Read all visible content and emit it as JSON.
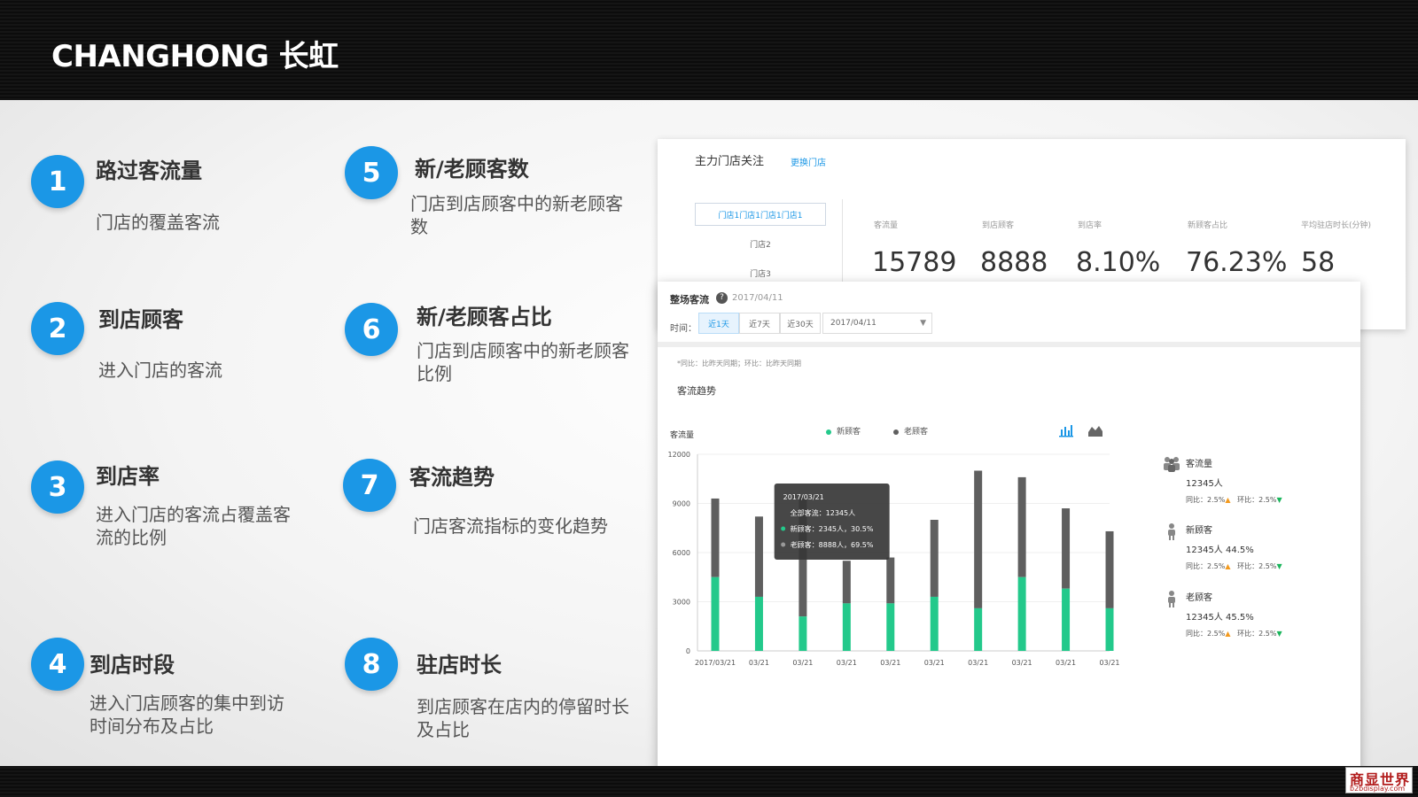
{
  "brand": {
    "logo_text": "CHANGHONG 长虹"
  },
  "features": [
    {
      "num": "1",
      "title": "路过客流量",
      "desc": "门店的覆盖客流"
    },
    {
      "num": "2",
      "title": "到店顾客",
      "desc": "进入门店的客流"
    },
    {
      "num": "3",
      "title": "到店率",
      "desc": "进入门店的客流占覆盖客流的比例"
    },
    {
      "num": "4",
      "title": "到店时段",
      "desc": "进入门店顾客的集中到访时间分布及占比"
    },
    {
      "num": "5",
      "title": "新/老顾客数",
      "desc": "门店到店顾客中的新老顾客数"
    },
    {
      "num": "6",
      "title": "新/老顾客占比",
      "desc": "门店到店顾客中的新老顾客比例"
    },
    {
      "num": "7",
      "title": "客流趋势",
      "desc": "门店客流指标的变化趋势"
    },
    {
      "num": "8",
      "title": "驻店时长",
      "desc": "到店顾客在店内的停留时长及占比"
    }
  ],
  "store_panel": {
    "title": "主力门店关注",
    "change_link": "更换门店",
    "selected_store": "门店1门店1门店1门店1",
    "stores": [
      "门店2",
      "门店3"
    ],
    "metrics": [
      {
        "label": "客流量",
        "value": "15789"
      },
      {
        "label": "到店顾客",
        "value": "8888"
      },
      {
        "label": "到店率",
        "value": "8.10%"
      },
      {
        "label": "新顾客占比",
        "value": "76.23%"
      },
      {
        "label": "平均驻店时长(分钟)",
        "value": "58"
      }
    ]
  },
  "traffic_panel": {
    "title": "整场客流",
    "help": "?",
    "date": "2017/04/11",
    "time_label": "时间：",
    "tabs": [
      "近1天",
      "近7天",
      "近30天"
    ],
    "date_select": "2017/04/11",
    "note": "*同比：比昨天同期；环比：比昨天同期",
    "section_title": "客流趋势",
    "y_axis_label": "客流量",
    "legend_new": "新顾客",
    "legend_old": "老顾客",
    "tooltip": {
      "date": "2017/03/21",
      "total": "全部客流：12345人",
      "new": "新顾客：2345人，30.5%",
      "old": "老顾客：8888人，69.5%"
    },
    "stats": [
      {
        "title": "客流量",
        "value": "12345人",
        "yoy": "同比：2.5%",
        "mom": "环比：2.5%"
      },
      {
        "title": "新顾客",
        "value": "12345人  44.5%",
        "yoy": "同比：2.5%",
        "mom": "环比：2.5%"
      },
      {
        "title": "老顾客",
        "value": "12345人  45.5%",
        "yoy": "同比：2.5%",
        "mom": "环比：2.5%"
      }
    ]
  },
  "colors": {
    "accent": "#1b97e6",
    "new_customer": "#23c98b",
    "old_customer": "#5f5f5f",
    "up": "#f39a1e",
    "down": "#19b55b"
  },
  "watermark": {
    "cn": "商显世界",
    "en": "b2bdisplay.com"
  },
  "chart_data": {
    "type": "bar",
    "stacked": true,
    "categories": [
      "2017/03/21",
      "03/21",
      "03/21",
      "03/21",
      "03/21",
      "03/21",
      "03/21",
      "03/21",
      "03/21",
      "03/21"
    ],
    "series": [
      {
        "name": "新顾客",
        "values": [
          4500,
          3300,
          2100,
          2900,
          2900,
          3300,
          2600,
          4500,
          3800,
          2600
        ]
      },
      {
        "name": "老顾客",
        "values": [
          4800,
          4900,
          7300,
          2600,
          2800,
          4700,
          8400,
          6100,
          4900,
          4700
        ]
      }
    ],
    "ylabel": "客流量",
    "ylim": [
      0,
      12000
    ],
    "yticks": [
      0,
      3000,
      6000,
      9000,
      12000
    ],
    "legend_position": "top"
  }
}
